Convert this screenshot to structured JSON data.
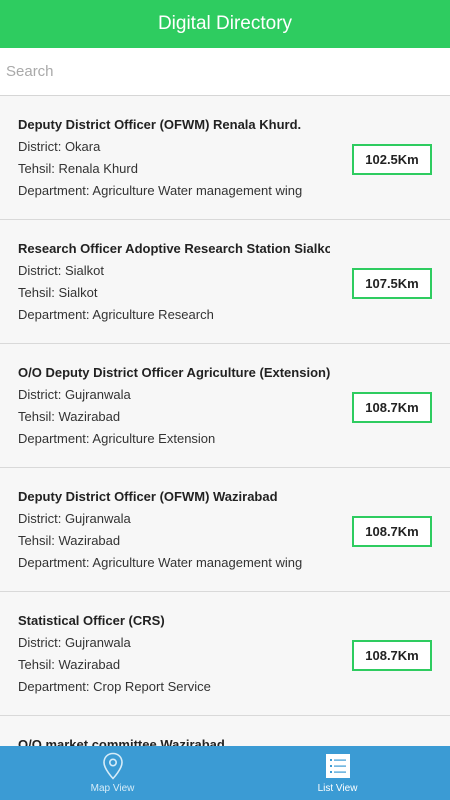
{
  "header": {
    "title": "Digital Directory"
  },
  "search": {
    "placeholder": "Search"
  },
  "list": {
    "items": [
      {
        "title": "Deputy District Officer (OFWM) Renala Khurd.",
        "district": "District: Okara",
        "tehsil": "Tehsil: Renala Khurd",
        "department": "Department: Agriculture Water management wing",
        "distance": "102.5Km"
      },
      {
        "title": "Research Officer Adoptive Research Station Sialkot",
        "district": "District: Sialkot",
        "tehsil": "Tehsil: Sialkot",
        "department": "Department: Agriculture Research",
        "distance": "107.5Km"
      },
      {
        "title": "O/O Deputy District Officer Agriculture (Extension)",
        "district": "District: Gujranwala",
        "tehsil": "Tehsil: Wazirabad",
        "department": "Department: Agriculture Extension",
        "distance": "108.7Km"
      },
      {
        "title": "Deputy District Officer (OFWM) Wazirabad",
        "district": "District: Gujranwala",
        "tehsil": "Tehsil: Wazirabad",
        "department": "Department: Agriculture Water management wing",
        "distance": "108.7Km"
      },
      {
        "title": "Statistical Officer (CRS)",
        "district": "District: Gujranwala",
        "tehsil": "Tehsil: Wazirabad",
        "department": "Department: Crop Report Service",
        "distance": "108.7Km"
      },
      {
        "title": "O/O market committee Wazirabad",
        "district": "",
        "tehsil": "",
        "department": "",
        "distance": ""
      }
    ]
  },
  "tabbar": {
    "tabs": [
      {
        "label": "Map View",
        "icon": "map-pin-icon",
        "active": false
      },
      {
        "label": "List View",
        "icon": "list-icon",
        "active": true
      }
    ]
  },
  "colors": {
    "accent_green": "#2ecc60",
    "tabbar_blue": "#3b9bd4"
  }
}
